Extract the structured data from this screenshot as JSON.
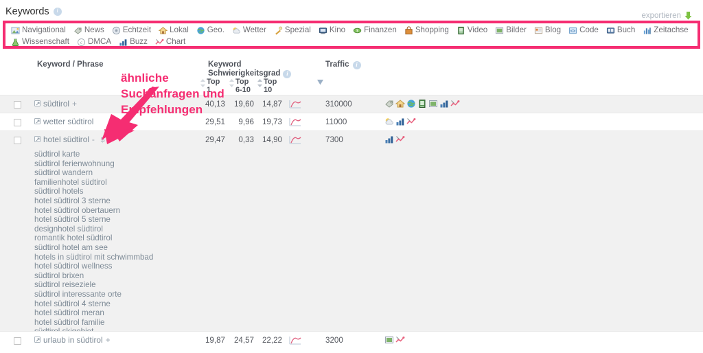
{
  "header": {
    "title": "Keywords",
    "info_icon": "info-icon",
    "export_label": "exportieren",
    "export_icon": "download-arrow-icon"
  },
  "colors": {
    "annotation": "#f52d72",
    "row_alt": "#f1f1f1",
    "text": "#55585f",
    "link": "#7d8a96",
    "export": "#b0b7c0"
  },
  "filters": [
    {
      "label": "Navigational",
      "icon": "navigational-icon"
    },
    {
      "label": "News",
      "icon": "news-tag-icon"
    },
    {
      "label": "Echtzeit",
      "icon": "realtime-icon"
    },
    {
      "label": "Lokal",
      "icon": "local-house-icon"
    },
    {
      "label": "Geo.",
      "icon": "globe-icon"
    },
    {
      "label": "Wetter",
      "icon": "weather-cloud-icon"
    },
    {
      "label": "Spezial",
      "icon": "special-wand-icon"
    },
    {
      "label": "Kino",
      "icon": "cinema-icon"
    },
    {
      "label": "Finanzen",
      "icon": "finance-money-icon"
    },
    {
      "label": "Shopping",
      "icon": "shopping-bag-icon"
    },
    {
      "label": "Video",
      "icon": "video-icon"
    },
    {
      "label": "Bilder",
      "icon": "images-icon"
    },
    {
      "label": "Blog",
      "icon": "blog-icon"
    },
    {
      "label": "Code",
      "icon": "code-icon"
    },
    {
      "label": "Buch",
      "icon": "book-icon"
    },
    {
      "label": "Zeitachse",
      "icon": "timeline-icon"
    },
    {
      "label": "Wissenschaft",
      "icon": "science-flask-icon"
    },
    {
      "label": "DMCA",
      "icon": "copyright-icon"
    },
    {
      "label": "Buzz",
      "icon": "buzz-bars-icon"
    },
    {
      "label": "Chart",
      "icon": "chart-icon"
    }
  ],
  "table": {
    "headers": {
      "keyword": "Keyword / Phrase",
      "difficulty_line1": "Keyword",
      "difficulty_line2": "Schwierigkeitsgrad",
      "traffic": "Traffic",
      "sub": [
        "Top 1",
        "Top 6-10",
        "Top 10"
      ],
      "sub_top": "Top",
      "sub_1": "1",
      "sub_6_10": "6-10",
      "sub_10": "10"
    },
    "rows": [
      {
        "keyword": "südtirol",
        "suffix": "+",
        "has_dollar": false,
        "top1": "40,13",
        "top6_10": "19,60",
        "top10": "14,87",
        "traffic": "310000",
        "icons": [
          "news-tag-icon",
          "local-house-icon",
          "globe-icon",
          "video-icon",
          "images-icon",
          "buzz-bars-icon",
          "chart-icon"
        ]
      },
      {
        "keyword": "wetter südtirol",
        "suffix": "",
        "has_dollar": false,
        "top1": "29,51",
        "top6_10": "9,96",
        "top10": "19,73",
        "traffic": "11000",
        "icons": [
          "weather-cloud-icon",
          "buzz-bars-icon",
          "chart-icon"
        ]
      },
      {
        "keyword": "hotel südtirol",
        "suffix": "-",
        "has_dollar": true,
        "top1": "29,47",
        "top6_10": "0,33",
        "top10": "14,90",
        "traffic": "7300",
        "icons": [
          "buzz-bars-icon",
          "chart-icon"
        ],
        "suggestions": [
          "südtirol karte",
          "südtirol ferienwohnung",
          "südtirol wandern",
          "familienhotel südtirol",
          "südtirol hotels",
          "hotel südtirol 3 sterne",
          "hotel südtirol obertauern",
          "hotel südtirol 5 sterne",
          "designhotel südtirol",
          "romantik hotel südtirol",
          "südtirol hotel am see",
          "hotels in südtirol mit schwimmbad",
          "hotel südtirol wellness",
          "südtirol brixen",
          "südtirol reiseziele",
          "südtirol interessante orte",
          "hotel südtirol 4 sterne",
          "hotel südtirol meran",
          "hotel südtirol familie",
          "südtirol skigebiet"
        ]
      },
      {
        "keyword": "urlaub in südtirol",
        "suffix": "+",
        "has_dollar": false,
        "top1": "19,87",
        "top6_10": "24,57",
        "top10": "22,22",
        "traffic": "3200",
        "icons": [
          "images-icon",
          "chart-icon"
        ]
      }
    ]
  },
  "annotation": {
    "line1": "ähnliche",
    "line2": "Suchanfragen und",
    "line3": "Empfehlungen",
    "arrow": "arrow-pointing-down-left"
  }
}
